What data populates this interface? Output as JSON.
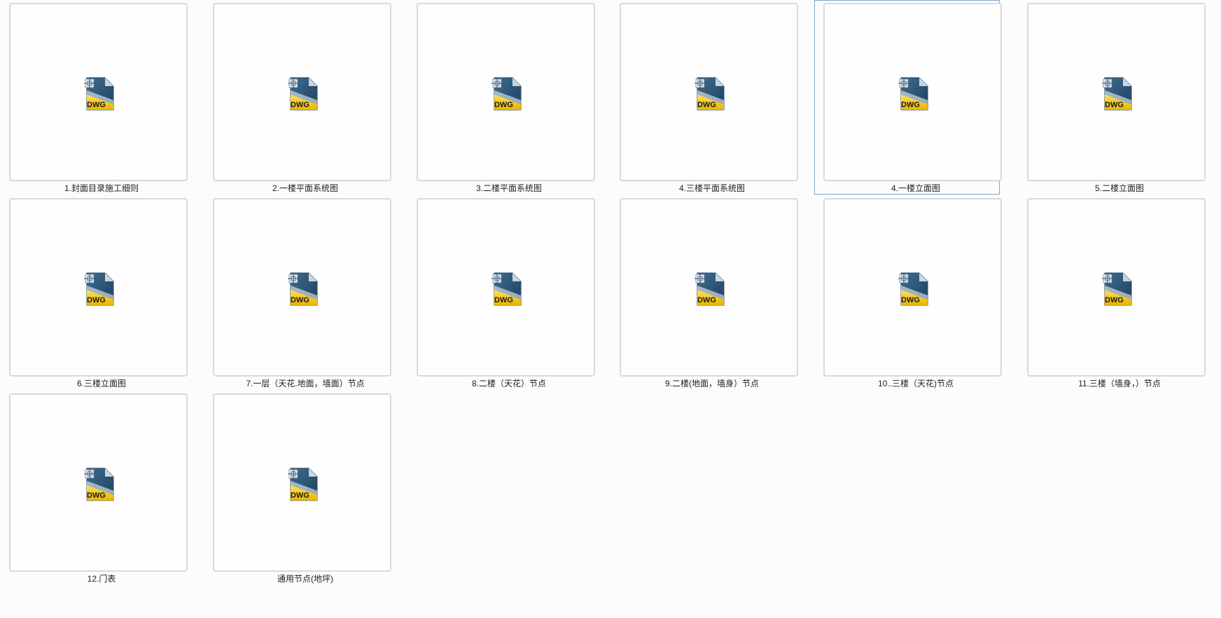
{
  "view": "large-icons",
  "selected_index": 4,
  "icon_type": "dwg-file-icon",
  "icon_text": "DWG",
  "files": [
    "1.封面目录施工细则",
    "2.一楼平面系统图",
    "3.二楼平面系统图",
    "4.三楼平面系统图",
    "4.一楼立面图",
    "5.二楼立面图",
    "6.三楼立面图",
    "7.一层（天花.地面，墙面）节点",
    "8.二楼（天花）节点",
    "9.二楼(地面，墙身）节点",
    "10..三楼（天花)节点",
    "11.三楼（墙身，）节点",
    "12.门表",
    "通用节点(地坪)"
  ]
}
